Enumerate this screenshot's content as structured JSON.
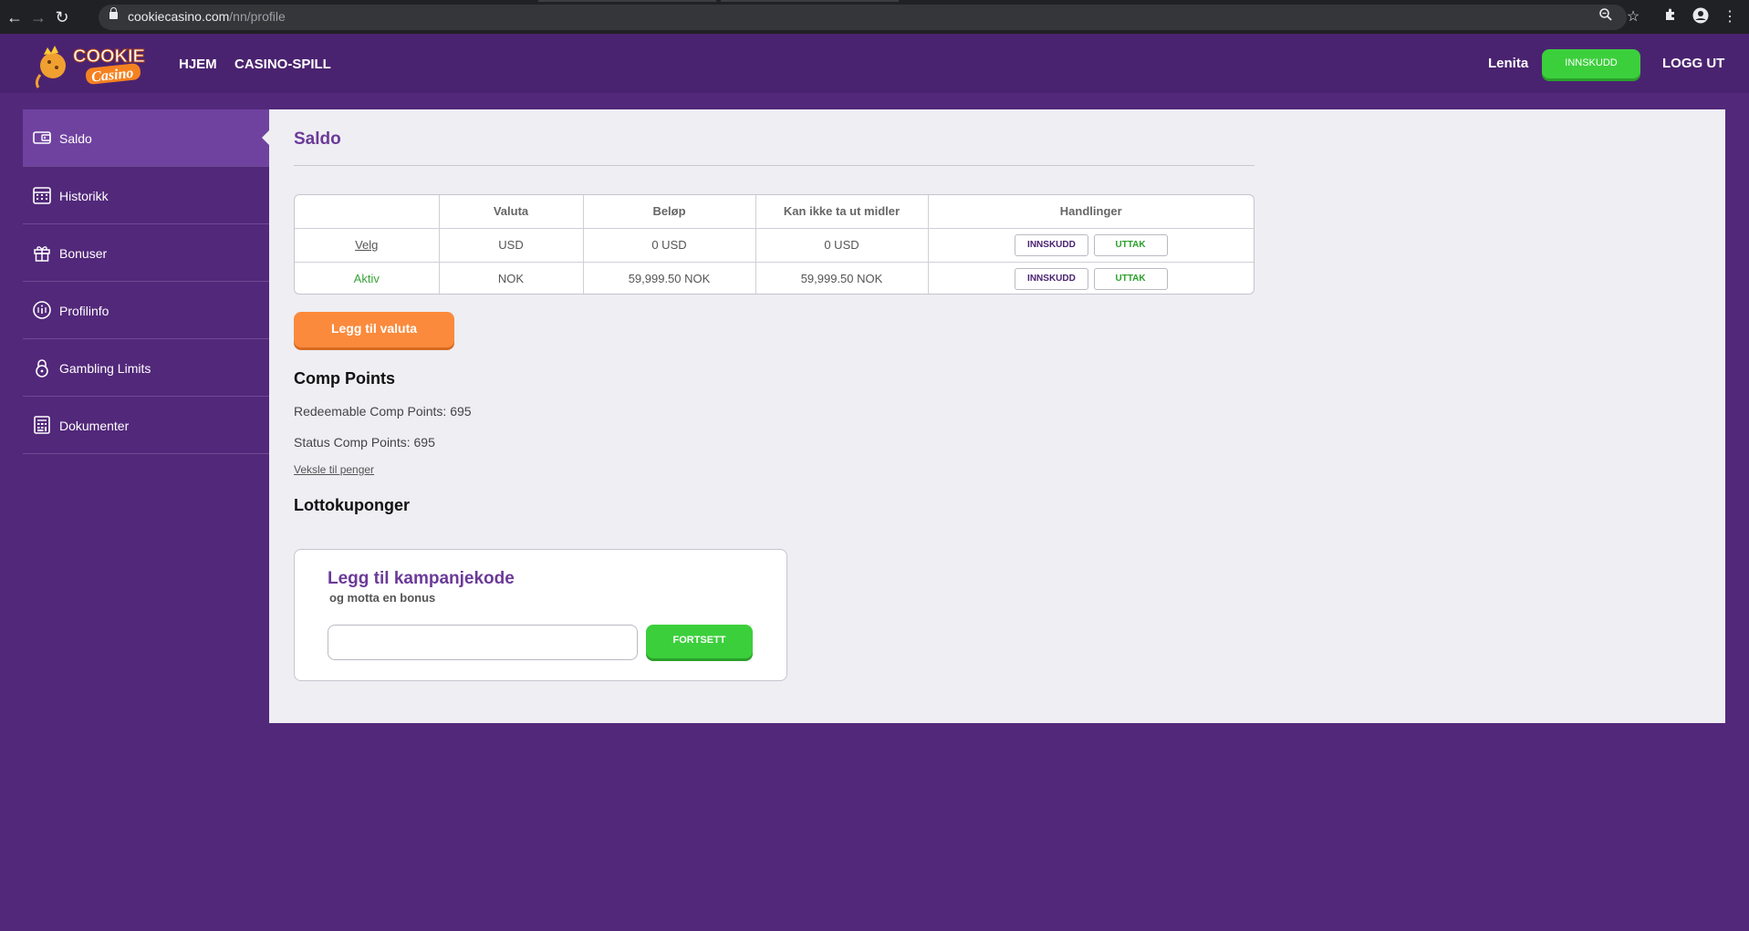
{
  "browser": {
    "url_host": "cookiecasino.com",
    "url_path": "/nn/profile",
    "icons": [
      "back-icon",
      "forward-icon",
      "reload-icon",
      "lock-icon",
      "zoom-icon",
      "star-icon",
      "extensions-icon",
      "profile-icon",
      "menu-icon"
    ]
  },
  "header": {
    "logo_alt": "Cookie Casino",
    "nav": [
      "HJEM",
      "CASINO-SPILL"
    ],
    "username": "Lenita",
    "deposit_label": "INNSKUDD",
    "logout_label": "LOGG UT",
    "colors": {
      "bar": "#4a2370",
      "deposit": "#3ccf3c"
    }
  },
  "sidebar": {
    "items": [
      {
        "label": "Saldo",
        "icon": "wallet-icon",
        "active": true
      },
      {
        "label": "Historikk",
        "icon": "calendar-icon",
        "active": false
      },
      {
        "label": "Bonuser",
        "icon": "gift-icon",
        "active": false
      },
      {
        "label": "Profilinfo",
        "icon": "profile-info-icon",
        "active": false
      },
      {
        "label": "Gambling Limits",
        "icon": "lock-icon",
        "active": false
      },
      {
        "label": "Dokumenter",
        "icon": "document-icon",
        "active": false
      }
    ]
  },
  "main": {
    "title": "Saldo",
    "table": {
      "headers": [
        "",
        "Valuta",
        "Beløp",
        "Kan ikke ta ut midler",
        "Handlinger"
      ],
      "rows": [
        {
          "status": "Velg",
          "currency": "USD",
          "amount": "0 USD",
          "locked": "0 USD",
          "deposit": "INNSKUDD",
          "withdraw": "UTTAK"
        },
        {
          "status": "Aktiv",
          "currency": "NOK",
          "amount": "59,999.50 NOK",
          "locked": "59,999.50 NOK",
          "deposit": "INNSKUDD",
          "withdraw": "UTTAK"
        }
      ]
    },
    "add_currency_label": "Legg til valuta",
    "comp_points": {
      "heading": "Comp Points",
      "redeemable": "Redeemable Comp Points: 695",
      "status": "Status Comp Points: 695",
      "exchange_link": "Veksle til penger"
    },
    "lottery_heading": "Lottokuponger",
    "promo": {
      "title": "Legg til kampanjekode",
      "subtitle": "og motta en bonus",
      "input_value": "",
      "button": "FORTSETT"
    }
  }
}
